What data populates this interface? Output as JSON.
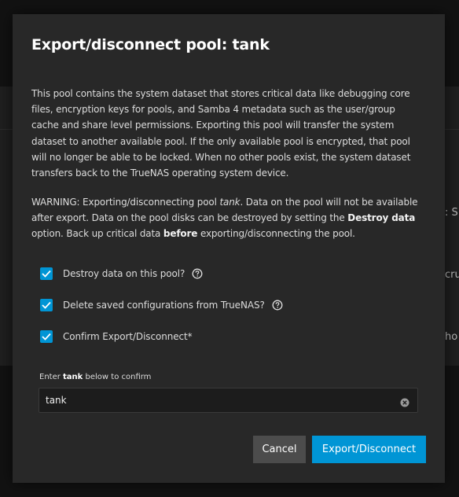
{
  "background": {
    "peek_texts": [
      ": S",
      "cru",
      "ho"
    ]
  },
  "dialog": {
    "title": "Export/disconnect pool: tank",
    "paragraph1": "This pool contains the system dataset that stores critical data like debugging core files, encryption keys for pools, and Samba 4 metadata such as the user/group cache and share level permissions. Exporting this pool will transfer the system dataset to another available pool. If the only available pool is encrypted, that pool will no longer be able to be locked. When no other pools exist, the system dataset transfers back to the TrueNAS operating system device.",
    "warning": {
      "prefix": "WARNING: Exporting/disconnecting pool ",
      "pool_name": "tank",
      "middle": ". Data on the pool will not be available after export. Data on the pool disks can be destroyed by setting the ",
      "destroy_data": "Destroy data",
      "middle2": " option. Back up critical data ",
      "before": "before",
      "suffix": " exporting/disconnecting the pool."
    },
    "checkboxes": [
      {
        "label": "Destroy data on this pool?",
        "checked": true,
        "has_help": true
      },
      {
        "label": "Delete saved configurations from TrueNAS?",
        "checked": true,
        "has_help": true
      },
      {
        "label": "Confirm Export/Disconnect*",
        "checked": true,
        "has_help": false
      }
    ],
    "confirm_input": {
      "label_prefix": "Enter ",
      "label_pool": "tank",
      "label_suffix": " below to confirm",
      "value": "tank"
    },
    "buttons": {
      "cancel": "Cancel",
      "export": "Export/Disconnect"
    }
  },
  "colors": {
    "accent": "#0095d5",
    "dialog_bg": "#282828",
    "cancel_bg": "#4c4c4c"
  }
}
